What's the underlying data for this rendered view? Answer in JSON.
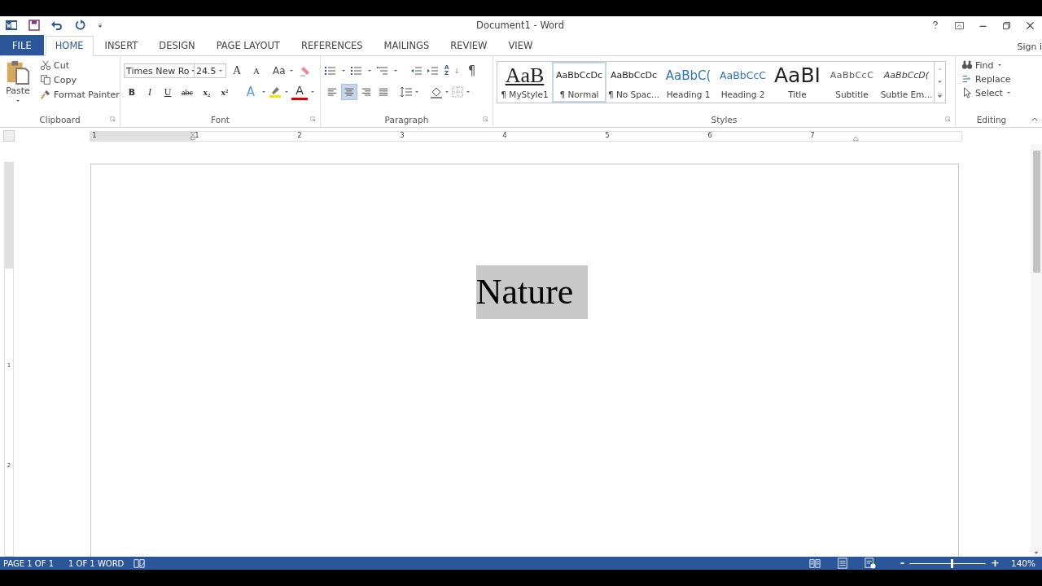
{
  "window": {
    "title": "Document1 - Word"
  },
  "tabs": [
    {
      "label": "FILE",
      "kind": "file",
      "selected": false
    },
    {
      "label": "HOME",
      "kind": "tab",
      "selected": true
    },
    {
      "label": "INSERT",
      "kind": "tab",
      "selected": false
    },
    {
      "label": "DESIGN",
      "kind": "tab",
      "selected": false
    },
    {
      "label": "PAGE LAYOUT",
      "kind": "tab",
      "selected": false
    },
    {
      "label": "REFERENCES",
      "kind": "tab",
      "selected": false
    },
    {
      "label": "MAILINGS",
      "kind": "tab",
      "selected": false
    },
    {
      "label": "REVIEW",
      "kind": "tab",
      "selected": false
    },
    {
      "label": "VIEW",
      "kind": "tab",
      "selected": false
    }
  ],
  "account": {
    "label": "Sign i"
  },
  "clipboard": {
    "label": "Clipboard",
    "paste": "Paste",
    "items": [
      {
        "label": "Cut",
        "kind": "cut"
      },
      {
        "label": "Copy",
        "kind": "copy"
      },
      {
        "label": "Format Painter",
        "kind": "painter"
      }
    ]
  },
  "font": {
    "label": "Font",
    "family": "Times New Ro",
    "size": "24.5",
    "grow": "A",
    "shrink": "A",
    "change_case": "Aa",
    "format_buttons": [
      {
        "label": "B",
        "kind": "bold"
      },
      {
        "label": "I",
        "kind": "italic"
      },
      {
        "label": "U",
        "kind": "underline"
      },
      {
        "label": "abc",
        "kind": "strike"
      },
      {
        "label": "x₂",
        "kind": "sub"
      },
      {
        "label": "x²",
        "kind": "sup"
      }
    ],
    "effects": [
      {
        "label": "A",
        "kind": "effects"
      },
      {
        "label": "A",
        "kind": "color"
      }
    ]
  },
  "paragraph": {
    "label": "Paragraph",
    "sort": [
      "A",
      "Z"
    ],
    "marks": "¶",
    "alignments": [
      {
        "kind": "left",
        "selected": false
      },
      {
        "kind": "center",
        "selected": true
      },
      {
        "kind": "right",
        "selected": false
      },
      {
        "kind": "justify",
        "selected": false
      }
    ]
  },
  "styles": {
    "label": "Styles",
    "items": [
      {
        "preview": "AaB",
        "name": "¶ MyStyle1",
        "kind": "mystyle",
        "selected": false
      },
      {
        "preview": "AaBbCcDc",
        "name": "¶ Normal",
        "kind": "normal",
        "selected": true
      },
      {
        "preview": "AaBbCcDc",
        "name": "¶ No Spac...",
        "kind": "normal",
        "selected": false
      },
      {
        "preview": "AaBbC(",
        "name": "Heading 1",
        "kind": "heading1",
        "selected": false
      },
      {
        "preview": "AaBbCcC",
        "name": "Heading 2",
        "kind": "heading2",
        "selected": false
      },
      {
        "preview": "AaBI",
        "name": "Title",
        "kind": "title",
        "selected": false
      },
      {
        "preview": "AaBbCcC",
        "name": "Subtitle",
        "kind": "subtitle",
        "selected": false
      },
      {
        "preview": "AaBbCcD(",
        "name": "Subtle Em...",
        "kind": "emphasis",
        "selected": false
      }
    ]
  },
  "editing": {
    "label": "Editing",
    "items": [
      {
        "label": "Find",
        "kind": "find"
      },
      {
        "label": "Replace",
        "kind": "replace"
      },
      {
        "label": "Select",
        "kind": "select"
      }
    ]
  },
  "ruler": {
    "numbers": [
      "1",
      "1",
      "2",
      "3",
      "4",
      "5",
      "6",
      "7"
    ],
    "vertical_numbers": [
      "1",
      "2"
    ]
  },
  "document": {
    "text": "Nature",
    "selected": true
  },
  "status_bar": {
    "page": "PAGE 1 OF 1",
    "words": "1 OF 1 WORD",
    "zoom": "140%",
    "zoom_slider": {
      "level": 0.55
    },
    "zoom_out": "-",
    "zoom_in": "+"
  }
}
